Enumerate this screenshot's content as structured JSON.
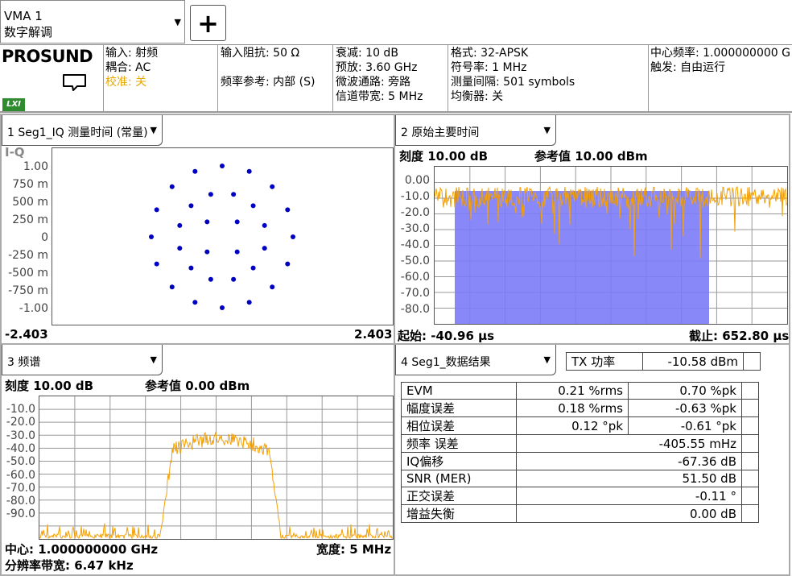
{
  "mode": {
    "line1": "VMA 1",
    "line2": "数字解调"
  },
  "info": {
    "logo": "PROSUND",
    "input": "输入: 射频",
    "coupling": "耦合: AC",
    "calib": "校准: 关",
    "impedance": "输入阻抗: 50 Ω",
    "freq_ref": "频率参考: 内部 (S)",
    "atten": "衰减: 10 dB",
    "preselect": "预放: 3.60 GHz",
    "mw_path": "微波通路: 旁路",
    "chan_bw": "信道带宽: 5 MHz",
    "format": "格式: 32-APSK",
    "symrate": "符号率: 1 MHz",
    "meas_interval": "测量间隔: 501 symbols",
    "equalizer": "均衡器: 关",
    "center_freq": "中心频率: 1.000000000 G",
    "trigger": "触发: 自由运行"
  },
  "p1": {
    "tab": "1 Seg1_IQ 测量时间 (常量)",
    "label": "I-Q",
    "yticks": [
      "1.00",
      "750 m",
      "500 m",
      "250 m",
      "0",
      "-250 m",
      "-500 m",
      "-750 m",
      "-1.00"
    ],
    "xmin": "-2.403",
    "xmax": "2.403"
  },
  "p2": {
    "tab": "2 原始主要时间",
    "scale": "刻度 10.00 dB",
    "ref": "参考值 10.00 dBm",
    "yticks": [
      "0.00",
      "-10.0",
      "-20.0",
      "-30.0",
      "-40.0",
      "-50.0",
      "-60.0",
      "-70.0",
      "-80.0"
    ],
    "start": "起始: -40.96 µs",
    "stop": "截止: 652.80 µs"
  },
  "p3": {
    "tab": "3 频谱",
    "scale": "刻度 10.00 dB",
    "ref": "参考值 0.00 dBm",
    "yticks": [
      "-10.0",
      "-20.0",
      "-30.0",
      "-40.0",
      "-50.0",
      "-60.0",
      "-70.0",
      "-80.0",
      "-90.0"
    ],
    "center": "中心: 1.000000000 GHz",
    "span": "宽度: 5 MHz",
    "rbw": "分辨率带宽: 6.47 kHz"
  },
  "p4": {
    "tab": "4 Seg1_数据结果",
    "tx_label": "TX 功率",
    "tx_value": "-10.58 dBm",
    "rows": [
      {
        "name": "EVM",
        "v1": "0.21 %rms",
        "v2": "0.70 %pk"
      },
      {
        "name": "幅度误差",
        "v1": "0.18 %rms",
        "v2": "-0.63 %pk"
      },
      {
        "name": "相位误差",
        "v1": "0.12 °pk",
        "v2": "-0.61 °pk"
      },
      {
        "name": "频率 误差",
        "v": "-405.55 mHz"
      },
      {
        "name": "IQ偏移",
        "v": "-67.36 dB"
      },
      {
        "name": "SNR (MER)",
        "v": "51.50 dB"
      },
      {
        "name": "正交误差",
        "v": "-0.11 °"
      },
      {
        "name": "增益失衡",
        "v": "0.00 dB"
      }
    ]
  },
  "colors": {
    "trace": "#f5a000",
    "fill": "#7b7bf7",
    "dot": "#0000c0"
  }
}
